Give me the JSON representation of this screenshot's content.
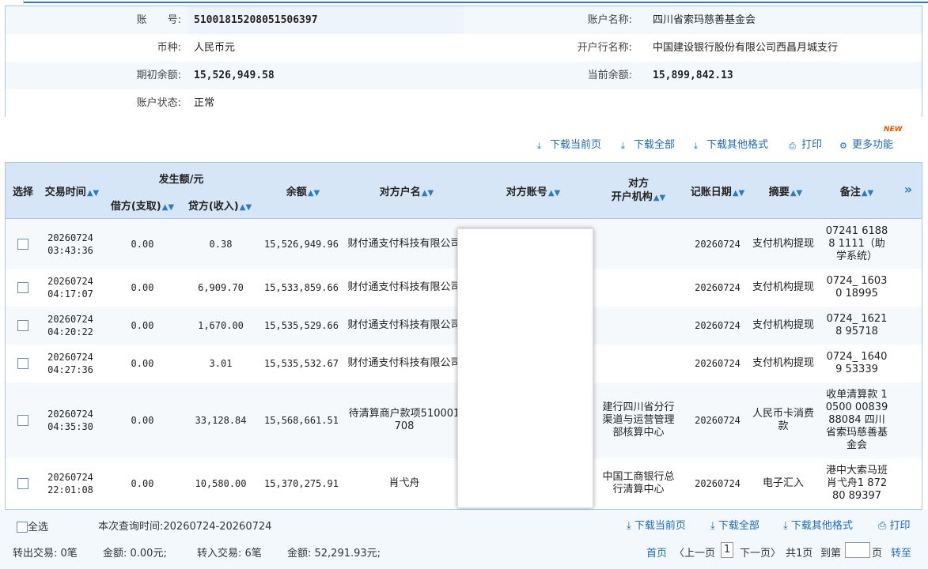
{
  "account": {
    "number_label": "账　　号:",
    "number": "51001815208051506397",
    "name_label": "账户名称:",
    "name": "四川省索玛慈善基金会",
    "currency_label": "币种:",
    "currency": "人民币元",
    "bank_label": "开户行名称:",
    "bank": "中国建设银行股份有限公司西昌月城支行",
    "opening_balance_label": "期初余额:",
    "opening_balance": "15,526,949.58",
    "current_balance_label": "当前余额:",
    "current_balance": "15,899,842.13",
    "status_label": "账户状态:",
    "status": "正常"
  },
  "toolbar": {
    "download_page": "下载当前页",
    "download_all": "下载全部",
    "download_other": "下载其他格式",
    "print": "打印",
    "more": "更多功能",
    "new_badge": "NEW"
  },
  "table": {
    "headers": {
      "select": "选择",
      "time": "交易时间",
      "amount_group": "发生额/元",
      "debit": "借方(支取)",
      "credit": "贷方(收入)",
      "balance": "余额",
      "party_name": "对方户名",
      "party_account": "对方账号",
      "party_bank_1": "对方",
      "party_bank_2": "开户机构",
      "post_date": "记账日期",
      "summary": "摘要",
      "remark": "备注",
      "more": "»"
    },
    "rows": [
      {
        "date": "20260724",
        "time": "03:43:36",
        "debit": "0.00",
        "credit": "0.38",
        "balance": "15,526,949.96",
        "party": "财付通支付科技有限公司",
        "bank": "",
        "post_date": "20260724",
        "summary": "支付机构提现",
        "remark": "07241 61888 1111（助学系统）"
      },
      {
        "date": "20260724",
        "time": "04:17:07",
        "debit": "0.00",
        "credit": "6,909.70",
        "balance": "15,533,859.66",
        "party": "财付通支付科技有限公司",
        "bank": "",
        "post_date": "20260724",
        "summary": "支付机构提现",
        "remark": "0724_ 16030 18995"
      },
      {
        "date": "20260724",
        "time": "04:20:22",
        "debit": "0.00",
        "credit": "1,670.00",
        "balance": "15,535,529.66",
        "party": "财付通支付科技有限公司",
        "bank": "",
        "post_date": "20260724",
        "summary": "支付机构提现",
        "remark": "0724_ 16218 95718"
      },
      {
        "date": "20260724",
        "time": "04:27:36",
        "debit": "0.00",
        "credit": "3.01",
        "balance": "15,535,532.67",
        "party": "财付通支付科技有限公司",
        "bank": "",
        "post_date": "20260724",
        "summary": "支付机构提现",
        "remark": "0724_ 16409 53339"
      },
      {
        "date": "20260724",
        "time": "04:35:30",
        "debit": "0.00",
        "credit": "33,128.84",
        "balance": "15,568,661.51",
        "party": "待清算商户款项510001708",
        "bank": "建行四川省分行渠道与运营管理部核算中心",
        "post_date": "20260724",
        "summary": "人民币卡消费款",
        "remark": "收单清算款 10500 00839 88084 四川省索玛慈善基金会"
      },
      {
        "date": "20260724",
        "time": "22:01:08",
        "debit": "0.00",
        "credit": "10,580.00",
        "balance": "15,370,275.91",
        "party": "肖弋舟",
        "bank": "中国工商银行总行清算中心",
        "post_date": "20260724",
        "summary": "电子汇入",
        "remark": "港中大索马班肖弋舟1 87280 89397"
      }
    ]
  },
  "footer": {
    "select_all": "全选",
    "query_time": "本次查询时间:20260724-20260724",
    "download_page": "下载当前页",
    "download_all": "下载全部",
    "download_other": "下载其他格式",
    "print": "打印",
    "out_tx": "转出交易: 0笔",
    "out_amount": "金额: 0.00元;",
    "in_tx": "转入交易: 6笔",
    "in_amount": "金额: 52,291.93元;",
    "first": "首页",
    "prev": "〈上一页",
    "page": "1",
    "next": "下一页〉",
    "total": "共1页",
    "goto": "到第",
    "page_unit": "页",
    "go": "转至"
  }
}
